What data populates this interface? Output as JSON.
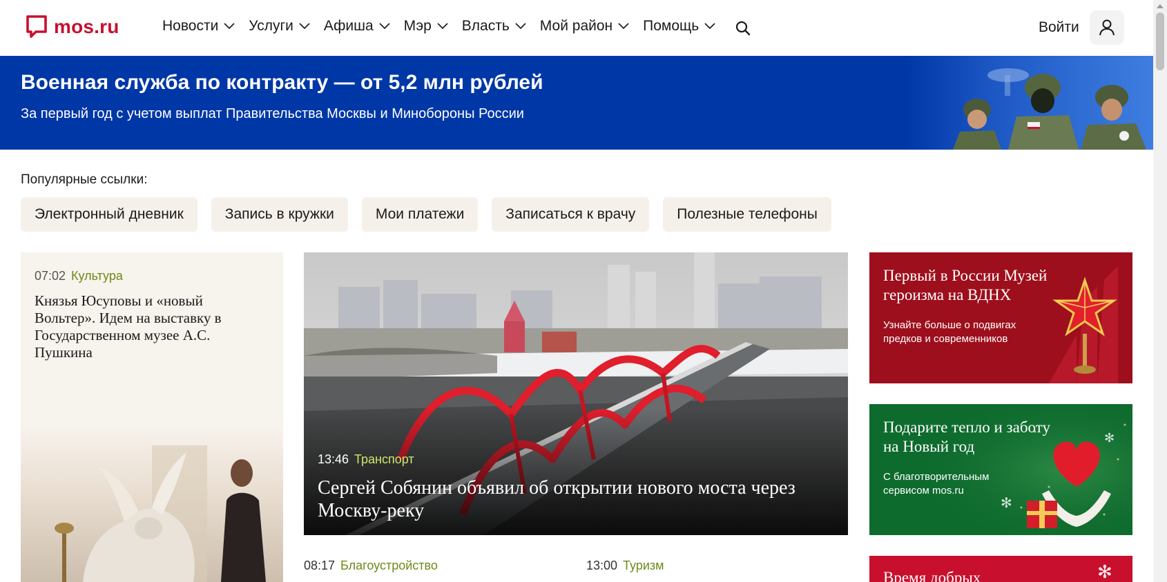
{
  "header": {
    "logo_text": "mos.ru",
    "nav": [
      "Новости",
      "Услуги",
      "Афиша",
      "Мэр",
      "Власть",
      "Мой район",
      "Помощь"
    ],
    "login_label": "Войти"
  },
  "banner": {
    "title": "Военная служба по контракту — от 5,2 млн рублей",
    "subtitle": "За первый год с учетом выплат Правительства Москвы и Минобороны России"
  },
  "popular": {
    "label": "Популярные ссылки:",
    "links": [
      "Электронный дневник",
      "Запись в кружки",
      "Мои платежи",
      "Записаться к врачу",
      "Полезные телефоны"
    ]
  },
  "left_card": {
    "time": "07:02",
    "category": "Культура",
    "title": "Князья Юсуповы и «новый Вольтер». Идем на выставку в Государственном музее А.С. Пушкина"
  },
  "feature": {
    "time": "13:46",
    "category": "Транспорт",
    "title": "Сергей Собянин объявил об открытии нового моста через Москву-реку"
  },
  "news": [
    {
      "time": "08:17",
      "category": "Благоустройство"
    },
    {
      "time": "13:00",
      "category": "Туризм"
    }
  ],
  "promos": [
    {
      "title": "Первый в России Музей героизма на ВДНХ",
      "desc": "Узнайте больше о подвигах предков и современников",
      "color": "#9d0f1c"
    },
    {
      "title": "Подарите тепло и заботу на Новый год",
      "desc": "С благотворительным сервисом mos.ru",
      "color": "#0e6b2e"
    },
    {
      "title": "Время добрых",
      "color": "#c8102e"
    }
  ],
  "colors": {
    "brand": "#c8102e",
    "banner": "#0037a6",
    "category": "#6c8a17",
    "chip": "#f5f1ea"
  }
}
